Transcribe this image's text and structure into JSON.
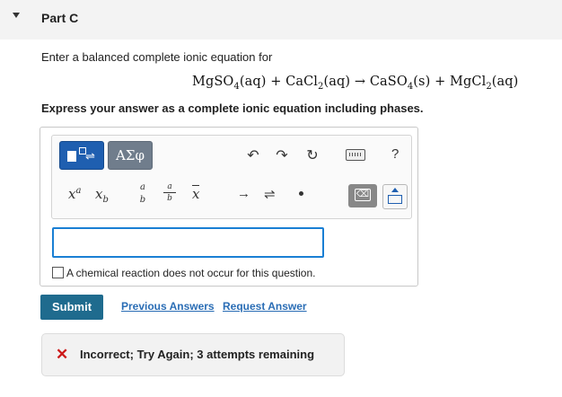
{
  "part": {
    "title": "Part C"
  },
  "question": {
    "instruction": "Enter a balanced complete ionic equation for",
    "express": "Express your answer as a complete ionic equation including phases."
  },
  "equation": {
    "r1": "MgSO",
    "r1_sub": "4",
    "r1_phase": "(aq)",
    "r2": "CaCl",
    "r2_sub": "2",
    "r2_phase": "(aq)",
    "p1": "CaSO",
    "p1_sub": "4",
    "p1_phase": "(s)",
    "p2": "MgCl",
    "p2_sub": "2",
    "p2_phase": "(aq)",
    "plus": "+",
    "arrow": "→"
  },
  "toolbar": {
    "greek_label": "ΑΣφ",
    "help_label": "?",
    "superscript_base": "x",
    "superscript_exp": "a",
    "subscript_base": "x",
    "subscript_sub": "b",
    "frac_num": "a",
    "frac_den": "b",
    "vec_label": "x",
    "right_arrow": "→",
    "equilibrium_arrow": "⇌",
    "delete_label": "⌫"
  },
  "answer": {
    "value": "",
    "no_reaction_label": "A chemical reaction does not occur for this question."
  },
  "actions": {
    "submit": "Submit",
    "previous_answers": "Previous Answers",
    "request_answer": "Request Answer"
  },
  "feedback": {
    "text": "Incorrect; Try Again; 3 attempts remaining",
    "color": "#cc1a1a"
  }
}
